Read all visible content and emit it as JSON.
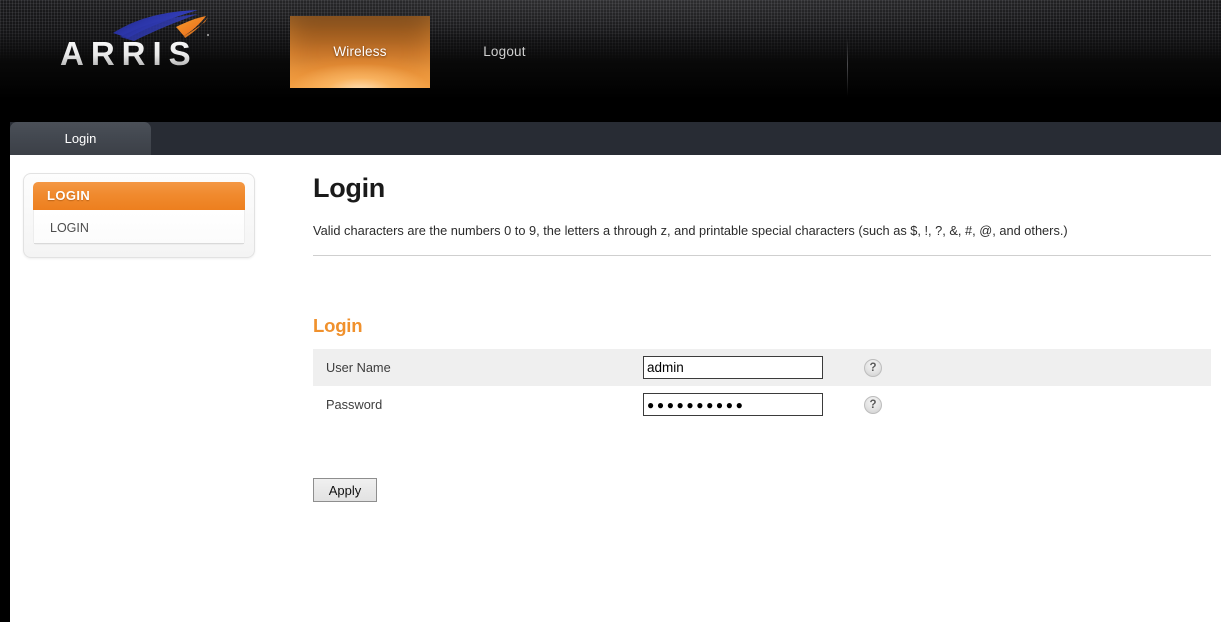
{
  "brand": {
    "logo_text": "ARRIS",
    "logo_alt": "arris-logo"
  },
  "topnav": {
    "items": [
      {
        "label": "Wireless",
        "active": true
      },
      {
        "label": "Logout",
        "active": false
      }
    ]
  },
  "tabs": [
    {
      "label": "Login",
      "active": true
    }
  ],
  "sidebar": {
    "header": "LOGIN",
    "items": [
      {
        "label": "LOGIN"
      }
    ]
  },
  "content": {
    "title": "Login",
    "description": "Valid characters are the numbers 0 to 9, the letters a through z, and printable special characters (such as $, !, ?, &, #, @, and others.)",
    "section_title": "Login",
    "form": {
      "rows": [
        {
          "label": "User Name",
          "value": "admin",
          "type": "text",
          "help": "?"
        },
        {
          "label": "Password",
          "value": "●●●●●●●●●●",
          "type": "password",
          "help": "?"
        }
      ]
    },
    "apply_label": "Apply"
  },
  "colors": {
    "accent_orange": "#f0912d",
    "sidebar_header_orange": "#ed7f1f",
    "masthead_black": "#000000",
    "tabstrip_gray": "#282c34",
    "row_shaded": "#efefef"
  }
}
